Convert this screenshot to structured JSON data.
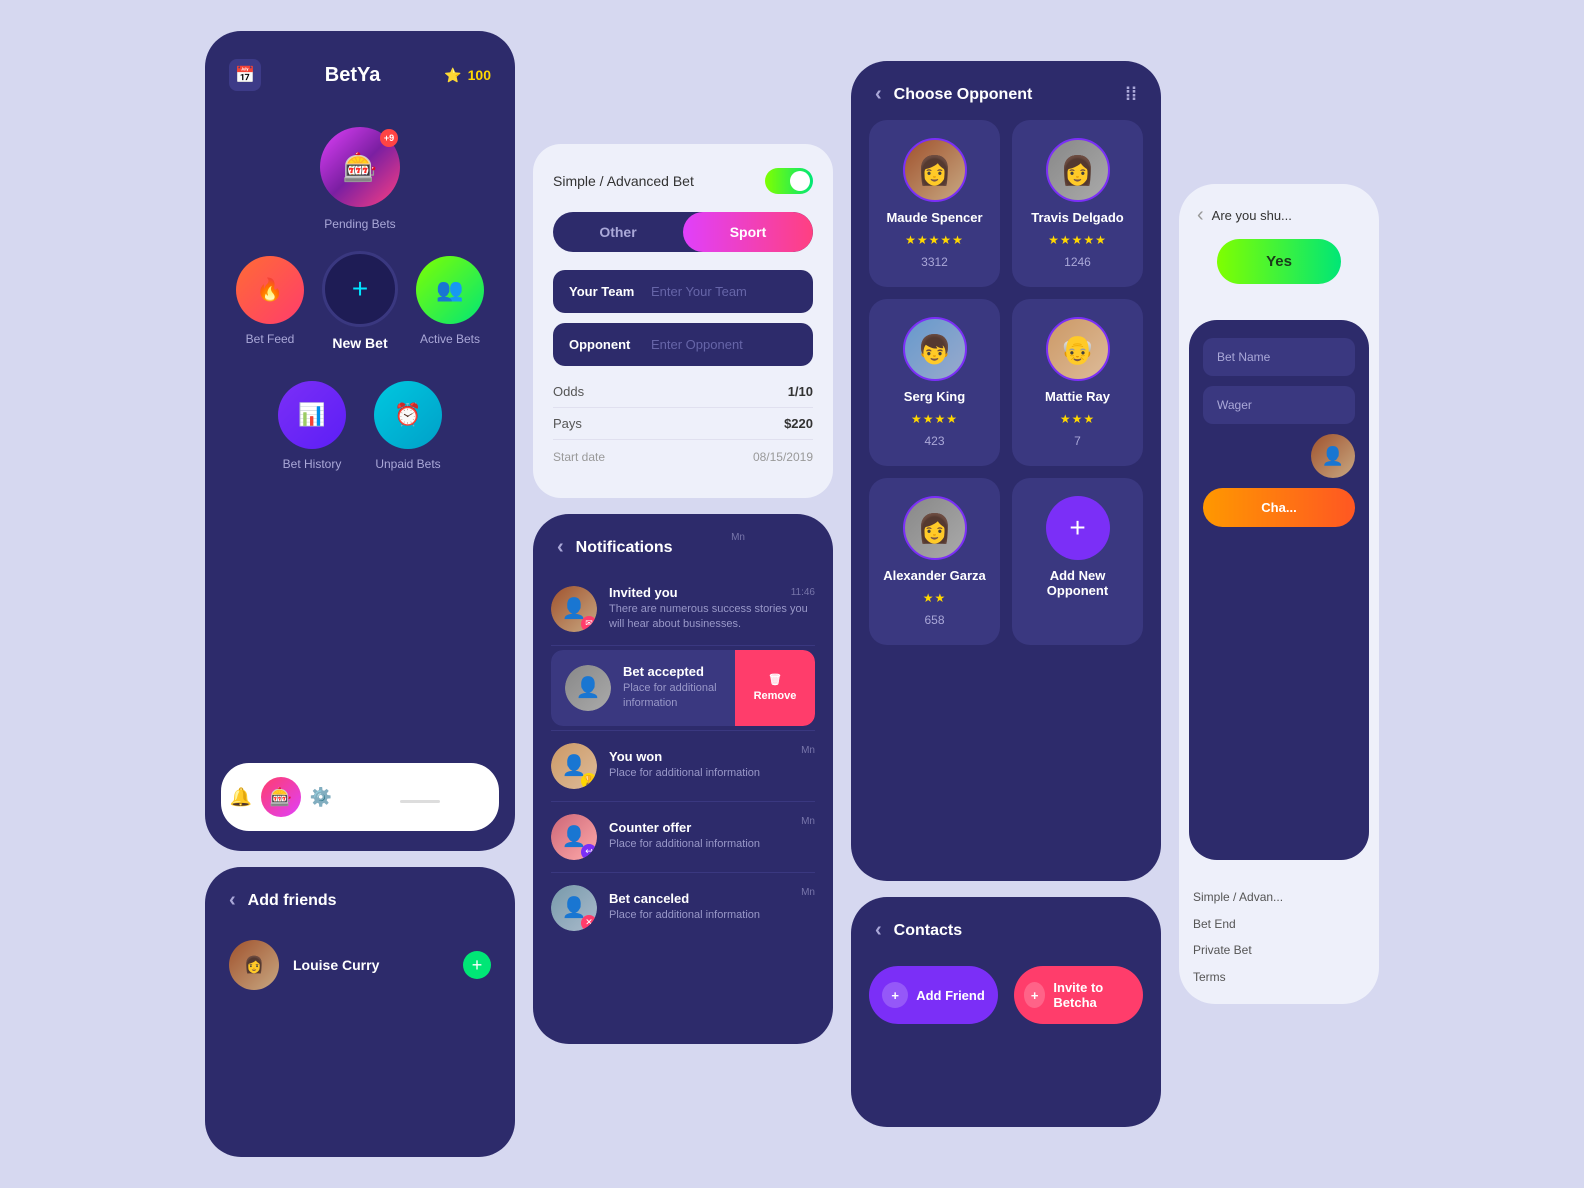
{
  "app": {
    "name": "BetYa",
    "stars": "100"
  },
  "main_menu": {
    "pending_bets": {
      "label": "Pending Bets",
      "badge": "+9"
    },
    "bet_feed": {
      "label": "Bet Feed"
    },
    "new_bet": {
      "label": "New Bet"
    },
    "active_bets": {
      "label": "Active Bets"
    },
    "bet_history": {
      "label": "Bet History"
    },
    "unpaid_bets": {
      "label": "Unpaid Bets"
    }
  },
  "bet_form": {
    "toggle_label": "Simple / Advanced Bet",
    "tab_other": "Other",
    "tab_sport": "Sport",
    "field_team_label": "Your Team",
    "field_team_placeholder": "Enter Your Team",
    "field_opp_label": "Opponent",
    "field_opp_placeholder": "Enter Opponent",
    "odds_label": "Odds",
    "odds_value": "1/10",
    "pays_label": "Pays",
    "pays_value": "$220",
    "date_label": "Start date",
    "date_value": "08/15/2019"
  },
  "notifications": {
    "title": "Notifications",
    "items": [
      {
        "title": "Invited you",
        "text": "There are numerous success stories you will hear about businesses.",
        "time": "11:46"
      },
      {
        "title": "Bet accepted",
        "text": "Place for additional information",
        "time": "Mn",
        "action": "Remove"
      },
      {
        "title": "You won",
        "text": "Place for additional information",
        "time": "Mn"
      },
      {
        "title": "Counter offer",
        "text": "Place for additional information",
        "time": "Mn"
      },
      {
        "title": "Bet canceled",
        "text": "Place for additional information",
        "time": "Mn"
      }
    ]
  },
  "choose_opponent": {
    "title": "Choose Opponent",
    "opponents": [
      {
        "name": "Maude Spencer",
        "stars": 5,
        "score": "3312"
      },
      {
        "name": "Travis Delgado",
        "stars": 5,
        "score": "1246"
      },
      {
        "name": "Serg King",
        "stars": 4,
        "score": "423"
      },
      {
        "name": "Mattie Ray",
        "stars": 3,
        "score": "7"
      },
      {
        "name": "Alexander Garza",
        "stars": 2,
        "score": "658"
      },
      {
        "name": "Add New Opponent",
        "is_add": true
      }
    ]
  },
  "contacts": {
    "title": "Contacts",
    "btn_add": "Add Friend",
    "btn_invite": "Invite to Betcha"
  },
  "add_friends": {
    "title": "Add friends",
    "person": {
      "name": "Louise Curry"
    }
  },
  "right_panel": {
    "question": "Are you shu...",
    "yes_btn": "Yes",
    "bet_name_label": "Bet Name",
    "wager_label": "Wager",
    "orange_btn": "Cha...",
    "settings_items": [
      "Simple / Advan...",
      "Bet End",
      "Private Bet",
      "Terms"
    ]
  }
}
